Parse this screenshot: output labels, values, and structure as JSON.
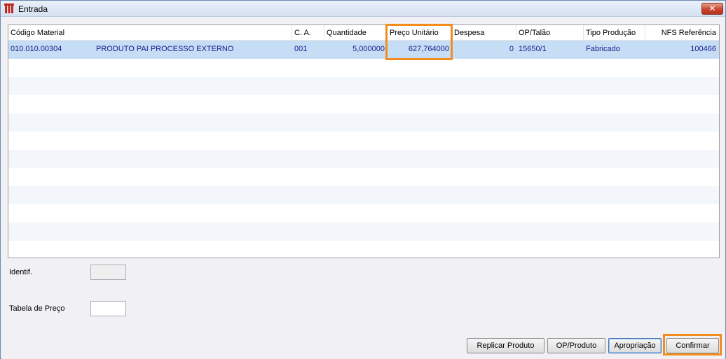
{
  "window": {
    "title": "Entrada",
    "close_symbol": "✕",
    "app_icon": "app-logo-icon",
    "close_icon": "close-icon"
  },
  "grid": {
    "columns": [
      {
        "key": "codigo",
        "label": "Código Material"
      },
      {
        "key": "ca",
        "label": "C. A."
      },
      {
        "key": "quantidade",
        "label": "Quantidade"
      },
      {
        "key": "preco",
        "label": "Preço Unitário"
      },
      {
        "key": "despesa",
        "label": "Despesa"
      },
      {
        "key": "op",
        "label": "OP/Talão"
      },
      {
        "key": "tipo",
        "label": "Tipo Produção"
      },
      {
        "key": "nfs",
        "label": "NFS Referência"
      }
    ],
    "rows": [
      {
        "codigo": "010.010.00304",
        "descricao": "PRODUTO PAI PROCESSO EXTERNO",
        "ca": "001",
        "quantidade": "5,000000",
        "preco": "627,764000",
        "despesa": "0",
        "op": "15650/1",
        "tipo": "Fabricado",
        "nfs": "100466"
      }
    ]
  },
  "form": {
    "identif_label": "Identif.",
    "identif_value": "",
    "tabela_label": "Tabela de Preço",
    "tabela_value": ""
  },
  "buttons": {
    "replicar": "Replicar Produto",
    "op_produto": "OP/Produto",
    "apropriacao": "Apropriação",
    "confirmar": "Confirmar"
  },
  "colors": {
    "highlight": "#f28c1e",
    "selected_row": "#c6def5"
  }
}
